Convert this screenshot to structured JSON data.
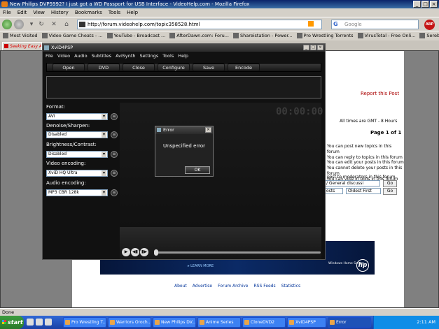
{
  "browser": {
    "title": "New Philips DVP5992? I just got a WD Passport for USB Interface - VideoHelp.com - Mozilla Firefox",
    "menu": [
      "File",
      "Edit",
      "View",
      "History",
      "Bookmarks",
      "Tools",
      "Help"
    ],
    "url": "http://forum.videohelp.com/topic358528.html",
    "search_placeholder": "Google",
    "bookmarks": [
      "Most Visited",
      "Video Game Cheats - ...",
      "YouTube - Broadcast ...",
      "AfterDawn.com: Foru...",
      "Shareistation - Power...",
      "Pro Wrestling Torrents",
      "VirusTotal - Free Onli...",
      "Serebii.net Diamond ..."
    ],
    "tab_label": "Seeking Easy As",
    "status_text": "Done",
    "adblock_label": "ABP"
  },
  "forum": {
    "report_link": "Report this Post",
    "times_note": "All times are GMT - 8 Hours",
    "page_of": "Page 1 of 1",
    "perms": [
      "You can post new topics in this forum",
      "You can reply to topics in this forum",
      "You can edit your posts in this forum",
      "You cannot delete your posts in this forum",
      "You can vote in polls in this forum"
    ],
    "post_mods": "post to moderators in this forum",
    "jump_select": "/ General discussi",
    "posts_select": "osts",
    "order_select": "Oldest First",
    "go_label": "Go",
    "banner_learn": "▸ LEARN MORE",
    "banner_ws": "Windows Home Server",
    "banner_hp": "hp",
    "footer": [
      "About",
      "Advertise",
      "Forum Archive",
      "RSS Feeds",
      "Statistics"
    ]
  },
  "app": {
    "title": "XviD4PSP",
    "menu": [
      "File",
      "Video",
      "Audio",
      "Subtitles",
      "AviSynth",
      "Settings",
      "Tools",
      "Help"
    ],
    "toolbar": [
      "Open",
      "DVD",
      "Close",
      "Configure",
      "Save",
      "Encode"
    ],
    "timer": "00:00:00",
    "format_label": "Format:",
    "format_value": "AVI",
    "denoise_label": "Denoise/Sharpen:",
    "denoise_value": "Disabled",
    "bright_label": "Brightness/Contrast:",
    "bright_value": "Disabled",
    "video_label": "Video encoding:",
    "video_value": "XviD HQ Ultra",
    "audio_label": "Audio encoding:",
    "audio_value": "MP3 CBR 128k"
  },
  "dialog": {
    "title": "Error",
    "message": "Unspecified error",
    "ok_label": "OK"
  },
  "taskbar": {
    "start_label": "start",
    "tasks": [
      "Pro Wrestling T...",
      "Warriors Oroch...",
      "New Philips DV...",
      "Anime Series",
      "CloneDVD2",
      "XviD4PSP",
      "Error"
    ],
    "clock": "2:11 AM"
  }
}
